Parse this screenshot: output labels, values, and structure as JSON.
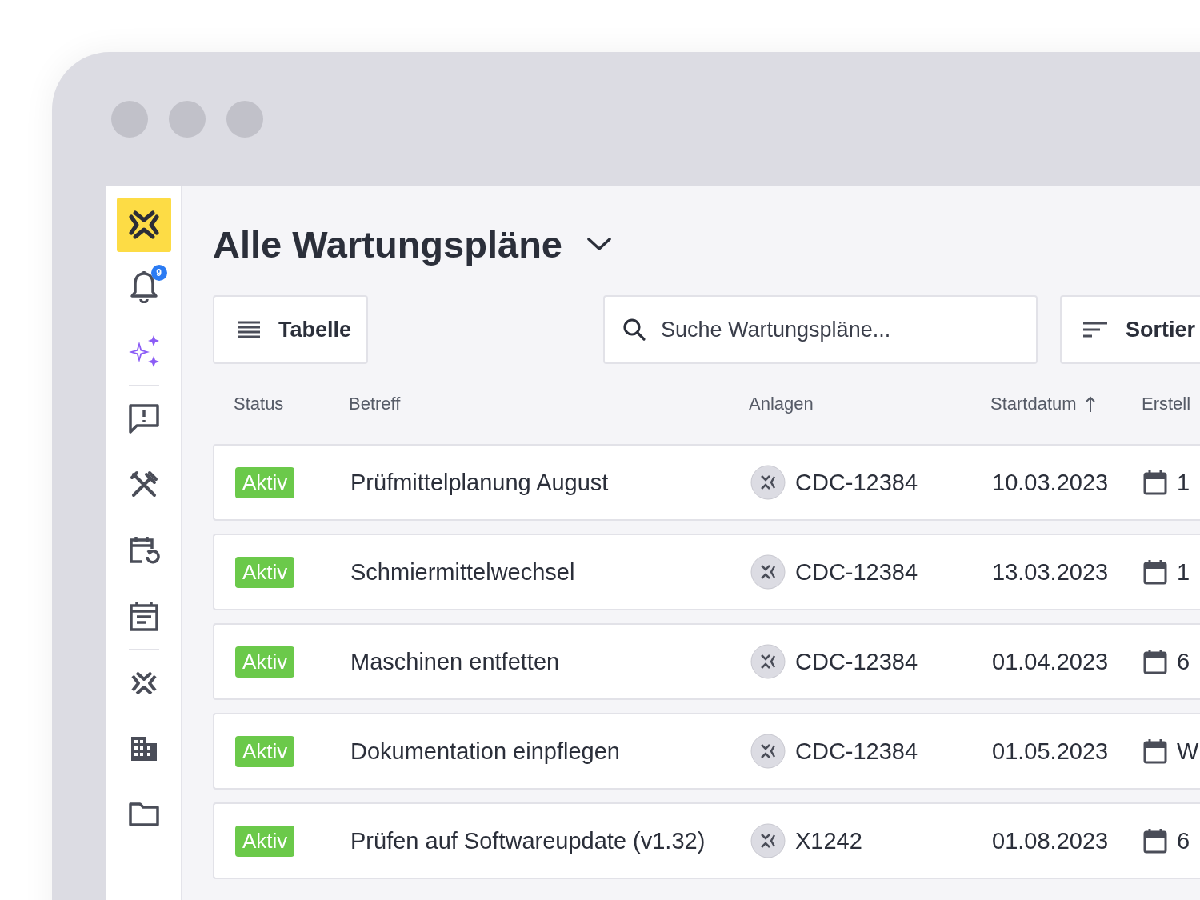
{
  "title": "Alle Wartungspläne",
  "notifications": {
    "count": "9"
  },
  "view_button": {
    "label": "Tabelle"
  },
  "search": {
    "placeholder": "Suche Wartungspläne..."
  },
  "sort_button": {
    "label": "Sortier"
  },
  "table": {
    "columns": [
      {
        "label": "Status",
        "sorted": false
      },
      {
        "label": "Betreff",
        "sorted": false
      },
      {
        "label": "Anlagen",
        "sorted": false
      },
      {
        "label": "Startdatum",
        "sorted": true
      },
      {
        "label": "Erstell"
      }
    ],
    "rows": [
      {
        "status": "Aktiv",
        "subject": "Prüfmittelplanung August",
        "asset": "CDC-12384",
        "start": "10.03.2023",
        "created": "1"
      },
      {
        "status": "Aktiv",
        "subject": "Schmiermittelwechsel",
        "asset": "CDC-12384",
        "start": "13.03.2023",
        "created": "1"
      },
      {
        "status": "Aktiv",
        "subject": "Maschinen entfetten",
        "asset": "CDC-12384",
        "start": "01.04.2023",
        "created": "6"
      },
      {
        "status": "Aktiv",
        "subject": "Dokumentation einpflegen",
        "asset": "CDC-12384",
        "start": "01.05.2023",
        "created": "W"
      },
      {
        "status": "Aktiv",
        "subject": "Prüfen auf Softwareupdate (v1.32)",
        "asset": "X1242",
        "start": "01.08.2023",
        "created": "6"
      }
    ]
  }
}
